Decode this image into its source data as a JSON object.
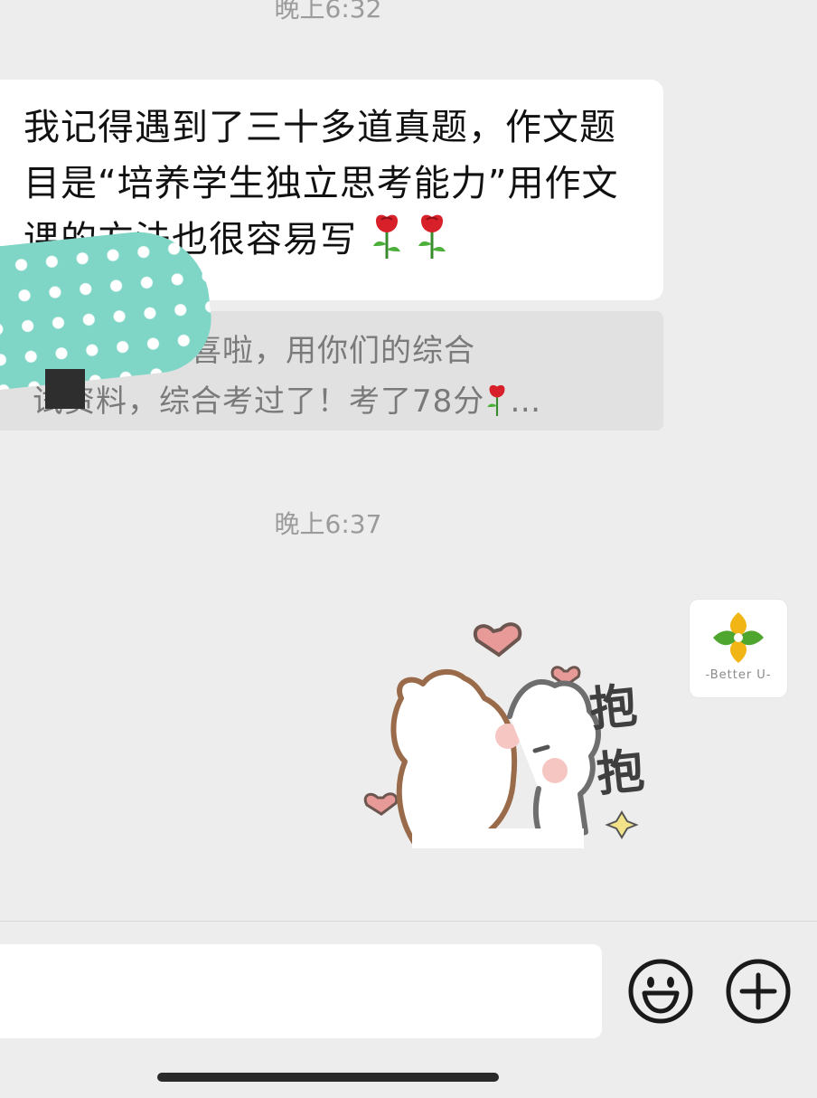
{
  "chat": {
    "timestamp_top": "晚上6:32",
    "timestamp_mid": "晚上6:37",
    "received_message": {
      "text": "我记得遇到了三十多道真题，作文题目是“培养学生独立思考能力”用作文课的方法也很容易写",
      "emoji": "rose-icon"
    },
    "quoted_message": {
      "line1": "老师我来报喜啦，用你们的综合",
      "line2_before": "试资料，综合考过了！考了78分",
      "line2_after": "…"
    },
    "sent_sticker": {
      "text_line1": "抱",
      "text_line2": "抱",
      "icon": "hug-sticker-icon"
    },
    "avatar": {
      "label": "-Better U-",
      "icon": "better-u-logo-icon"
    }
  },
  "input_bar": {
    "text_value": "",
    "emoji_button_icon": "smiley-icon",
    "more_button_icon": "plus-circle-icon"
  },
  "colors": {
    "background": "#ededed",
    "bubble": "#ffffff",
    "quote_bg": "#e1e1e1",
    "sticker_teal": "#7fd6c6"
  }
}
